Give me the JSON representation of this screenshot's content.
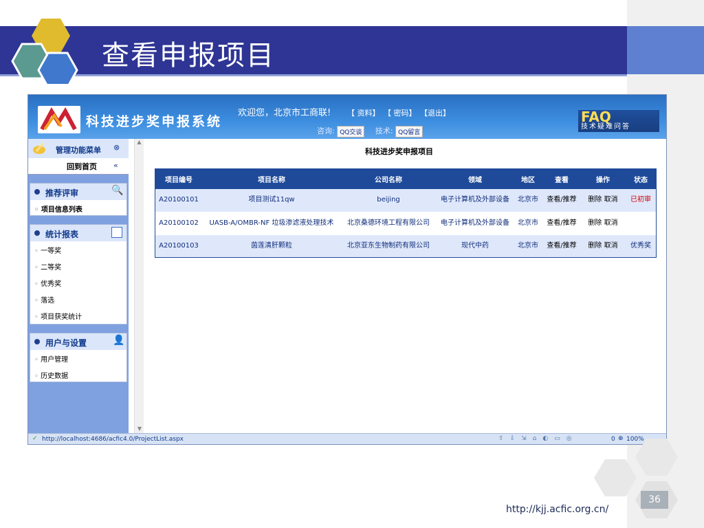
{
  "slide": {
    "title": "查看申报项目",
    "url": "http://kjj.acfic.org.cn/",
    "page_number": "36",
    "colors": {
      "banner": "#2e3594",
      "accent": "#5f7fd0"
    }
  },
  "app": {
    "system_name": "科技进步奖申报系统",
    "welcome": "欢迎您，北京市工商联!",
    "links": [
      "【 资料】",
      "【 密码】",
      "【退出】"
    ],
    "consult_label": "咨询:",
    "qq_chat": "QQ交谈",
    "tech_label": "技术:",
    "qq_message": "QQ留言",
    "faq_big": "FAQ",
    "faq_small": "技术疑难问答"
  },
  "sidebar": {
    "header": "管理功能菜单",
    "home": "回到首页",
    "panels": [
      {
        "title": "推荐评审",
        "items": [
          "项目信息列表"
        ]
      },
      {
        "title": "统计报表",
        "items": [
          "一等奖",
          "二等奖",
          "优秀奖",
          "落选",
          "项目获奖统计"
        ]
      },
      {
        "title": "用户与设置",
        "items": [
          "用户管理",
          "历史数据"
        ]
      }
    ]
  },
  "main": {
    "title": "科技进步奖申报项目",
    "columns": [
      "项目编号",
      "项目名称",
      "公司名称",
      "领域",
      "地区",
      "查看",
      "操作",
      "状态"
    ],
    "rows": [
      {
        "id": "A20100101",
        "name": "项目测试11qw",
        "company": "beijing",
        "field": "电子计算机及外部设备",
        "region": "北京市",
        "view": "查看/推荐",
        "ops": "删除 取消",
        "status": "已初审",
        "status_color": "#d40000"
      },
      {
        "id": "A20100102",
        "name": "UASB-A/OMBR-NF 垃圾渗滤液处理技术",
        "company": "北京桑德环境工程有限公司",
        "field": "电子计算机及外部设备",
        "region": "北京市",
        "view": "查看/推荐",
        "ops": "删除 取消",
        "status": "",
        "status_color": "#0e2c7a"
      },
      {
        "id": "A20100103",
        "name": "茵莲清肝颗粒",
        "company": "北京亚东生物制药有限公司",
        "field": "现代中药",
        "region": "北京市",
        "view": "查看/推荐",
        "ops": "删除 取消",
        "status": "优秀奖",
        "status_color": "#0e2c7a"
      }
    ]
  },
  "statusbar": {
    "url": "http://localhost:4686/acfic4.0/ProjectList.aspx",
    "count": "0",
    "zoom": "100%"
  }
}
